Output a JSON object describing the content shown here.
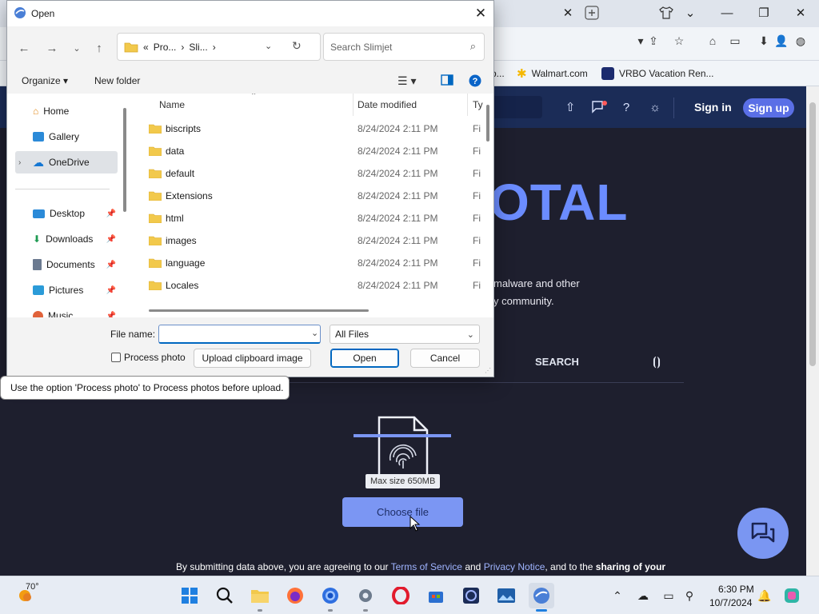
{
  "dialog": {
    "title": "Open",
    "breadcrumb": {
      "prefix": "«",
      "parts": [
        "Pro...",
        "Sli..."
      ]
    },
    "search_placeholder": "Search Slimjet",
    "organize_label": "Organize",
    "new_folder_label": "New folder",
    "nav": {
      "home": "Home",
      "gallery": "Gallery",
      "onedrive": "OneDrive",
      "desktop": "Desktop",
      "downloads": "Downloads",
      "documents": "Documents",
      "pictures": "Pictures",
      "music": "Music"
    },
    "columns": {
      "name": "Name",
      "date": "Date modified",
      "type": "Ty"
    },
    "files": [
      {
        "name": "biscripts",
        "date": "8/24/2024 2:11 PM",
        "type": "Fi"
      },
      {
        "name": "data",
        "date": "8/24/2024 2:11 PM",
        "type": "Fi"
      },
      {
        "name": "default",
        "date": "8/24/2024 2:11 PM",
        "type": "Fi"
      },
      {
        "name": "Extensions",
        "date": "8/24/2024 2:11 PM",
        "type": "Fi"
      },
      {
        "name": "html",
        "date": "8/24/2024 2:11 PM",
        "type": "Fi"
      },
      {
        "name": "images",
        "date": "8/24/2024 2:11 PM",
        "type": "Fi"
      },
      {
        "name": "language",
        "date": "8/24/2024 2:11 PM",
        "type": "Fi"
      },
      {
        "name": "Locales",
        "date": "8/24/2024 2:11 PM",
        "type": "Fi"
      }
    ],
    "file_name_label": "File name:",
    "file_name_value": "",
    "filter_value": "All Files",
    "process_photo_label": "Process photo",
    "upload_clipboard_label": "Upload clipboard image",
    "open_label": "Open",
    "cancel_label": "Cancel",
    "tooltip": "Use the option 'Process photo' to Process photos before upload."
  },
  "browser": {
    "bookmarks": [
      {
        "label": "o...",
        "icon": "bookmark-icon"
      },
      {
        "label": "Walmart.com",
        "icon": "walmart-icon"
      },
      {
        "label": "VRBO Vacation Ren...",
        "icon": "vrbo-icon"
      }
    ]
  },
  "site": {
    "signin": "Sign in",
    "signup": "Sign up",
    "logo_partial": "OTAL",
    "tagline_line1": "malware and other",
    "tagline_line2": "y community.",
    "search_tab": "SEARCH",
    "max_size": "Max size 650MB",
    "choose_file": "Choose file",
    "terms": {
      "pre": "By submitting data above, you are agreeing to our ",
      "tos": "Terms of Service",
      "mid": " and ",
      "privacy": "Privacy Notice",
      "post": ", and to the ",
      "bold": "sharing of your"
    },
    "accent": "#7b96f3"
  },
  "taskbar": {
    "weather_temp": "70°",
    "time": "6:30 PM",
    "date": "10/7/2024",
    "apps": [
      "start-icon",
      "search-icon",
      "file-explorer-icon",
      "firefox-icon",
      "chrome-icon",
      "settings-icon",
      "opera-icon",
      "store-icon",
      "app-icon",
      "photos-icon",
      "slimjet-icon"
    ]
  }
}
